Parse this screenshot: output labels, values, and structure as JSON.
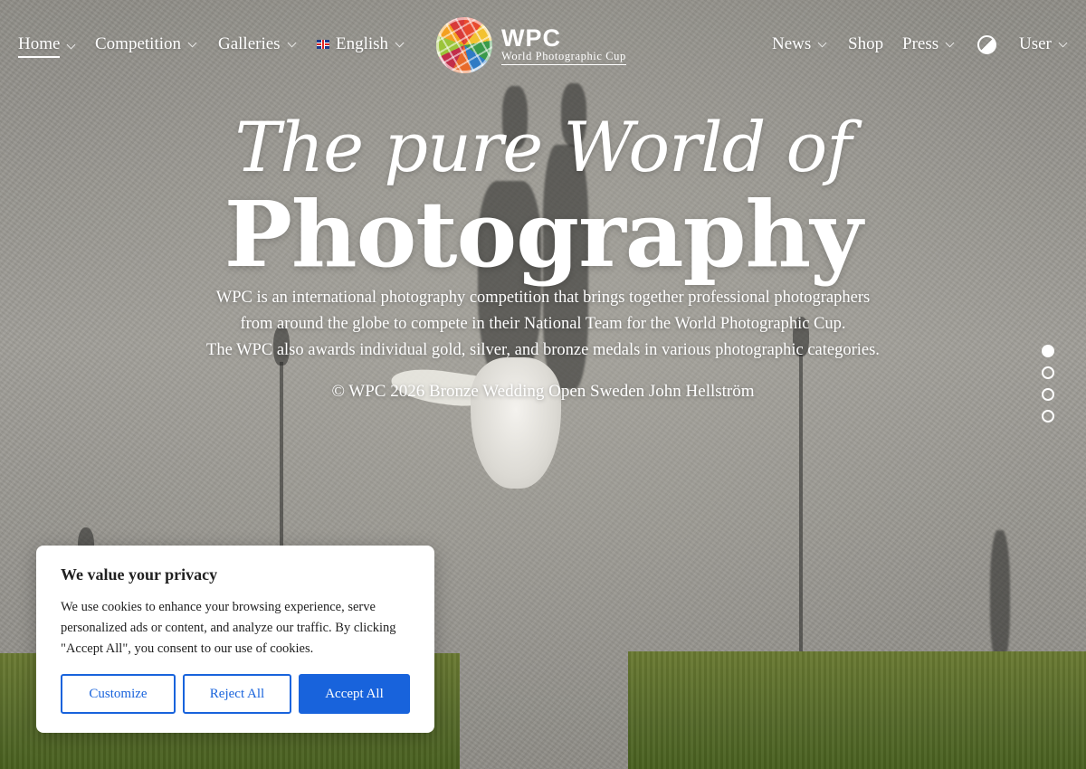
{
  "nav": {
    "left": [
      {
        "label": "Home",
        "active": true,
        "dropdown": true
      },
      {
        "label": "Competition",
        "dropdown": true
      },
      {
        "label": "Galleries",
        "dropdown": true
      },
      {
        "label": "English",
        "dropdown": true,
        "icon": "uk-flag-icon"
      }
    ],
    "right": [
      {
        "label": "News",
        "dropdown": true
      },
      {
        "label": "Shop",
        "dropdown": false
      },
      {
        "label": "Press",
        "dropdown": true
      },
      {
        "label": "User",
        "dropdown": true
      }
    ],
    "theme_toggle_icon": "contrast-icon"
  },
  "logo": {
    "title": "WPC",
    "subtitle": "World Photographic Cup"
  },
  "hero": {
    "script_title": "The pure World of",
    "big_title": "Photography",
    "description": [
      "WPC is an international photography competition that brings together professional photographers",
      "from around the globe to compete in their National Team for the World Photographic Cup.",
      "The WPC also awards individual gold, silver, and bronze medals in various photographic categories."
    ],
    "photo_credit": "© WPC 2026 Bronze Wedding Open Sweden John Hellström",
    "slides_total": 4,
    "active_slide": 1
  },
  "cookie": {
    "title": "We value your privacy",
    "text": "We use cookies to enhance your browsing experience, serve personalized ads or content, and analyze our traffic. By clicking \"Accept All\", you consent to our use of cookies.",
    "customize_label": "Customize",
    "reject_label": "Reject All",
    "accept_label": "Accept All"
  },
  "colors": {
    "accent": "#1863dc",
    "text_dark": "#212121"
  }
}
